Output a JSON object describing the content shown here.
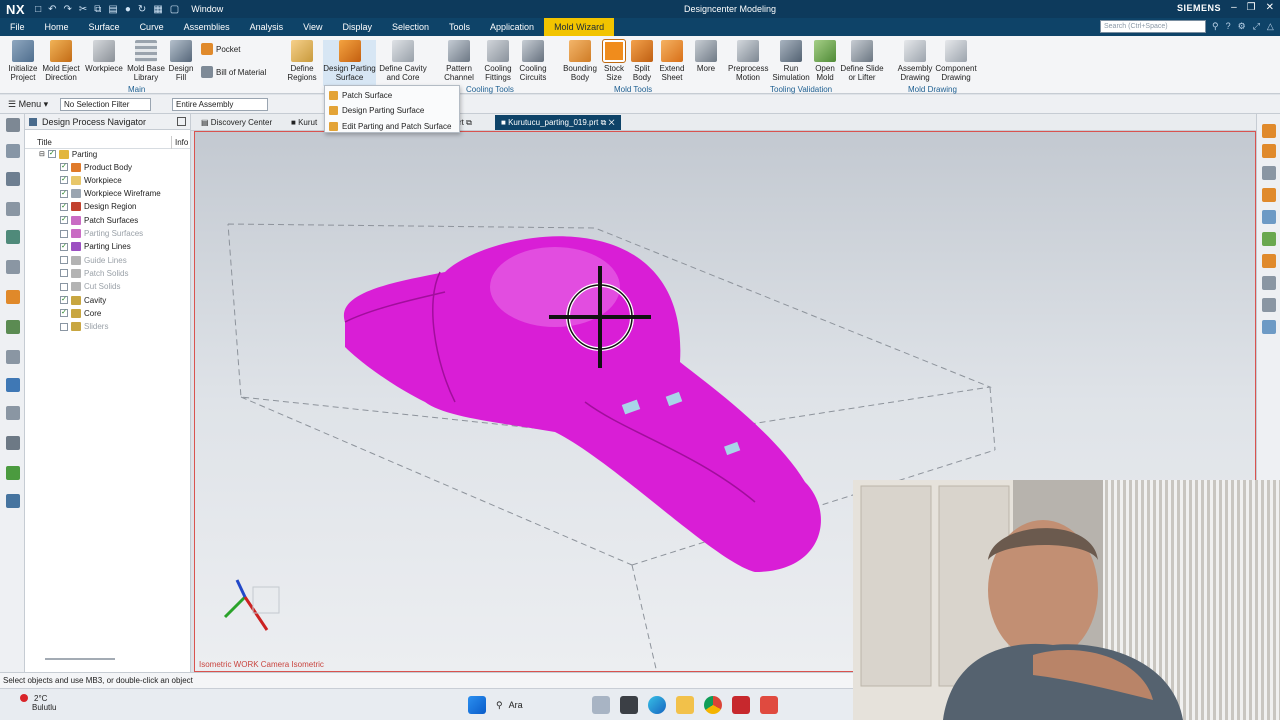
{
  "title_bar": {
    "logo": "NX",
    "window_menu": "Window",
    "app_title": "Designcenter Modeling",
    "brand": "SIEMENS"
  },
  "menu_bar": {
    "items": [
      "File",
      "Home",
      "Surface",
      "Curve",
      "Assemblies",
      "Analysis",
      "View",
      "Display",
      "Selection",
      "Tools",
      "Application",
      "Mold Wizard"
    ],
    "active": "Mold Wizard",
    "search_placeholder": "Search (Ctrl+Space)"
  },
  "ribbon": {
    "buttons": [
      {
        "label": "Initialize Project"
      },
      {
        "label": "Mold Eject Direction"
      },
      {
        "label": "Workpiece"
      },
      {
        "label": "Mold Base Library"
      },
      {
        "label": "Design Fill"
      },
      {
        "label": "Define Regions"
      },
      {
        "label": "Design Parting Surface"
      },
      {
        "label": "Define Cavity and Core"
      },
      {
        "label": "Pattern Channel"
      },
      {
        "label": "Cooling Fittings"
      },
      {
        "label": "Cooling Circuits"
      },
      {
        "label": "Bounding Body"
      },
      {
        "label": "Stock Size"
      },
      {
        "label": "Split Body"
      },
      {
        "label": "Extend Sheet"
      },
      {
        "label": "More"
      },
      {
        "label": "Preprocess Motion"
      },
      {
        "label": "Run Simulation"
      },
      {
        "label": "Open Mold"
      },
      {
        "label": "Define Slide or Lifter"
      },
      {
        "label": "Assembly Drawing"
      },
      {
        "label": "Component Drawing"
      }
    ],
    "small_buttons": {
      "pocket": "Pocket",
      "bom": "Bill of Material"
    },
    "groups": [
      "Main",
      "Cooling Tools",
      "Mold Tools",
      "Tooling Validation",
      "Mold Drawing"
    ]
  },
  "selection_bar": {
    "menu": "Menu",
    "filter": "No Selection Filter",
    "scope": "Entire Assembly"
  },
  "dropdown": {
    "items": [
      "Patch Surface",
      "Design Parting Surface",
      "Edit Parting and Patch Surface"
    ]
  },
  "navigator": {
    "title": "Design Process Navigator",
    "col_title": "Title",
    "col_info": "Info",
    "root": "Parting",
    "items": [
      {
        "label": "Product Body",
        "checked": true,
        "dim": false
      },
      {
        "label": "Workpiece",
        "checked": true,
        "dim": false
      },
      {
        "label": "Workpiece Wireframe",
        "checked": true,
        "dim": false
      },
      {
        "label": "Design Region",
        "checked": true,
        "dim": false
      },
      {
        "label": "Patch Surfaces",
        "checked": true,
        "dim": false
      },
      {
        "label": "Parting Surfaces",
        "checked": false,
        "dim": true
      },
      {
        "label": "Parting Lines",
        "checked": true,
        "dim": false
      },
      {
        "label": "Guide Lines",
        "checked": false,
        "dim": true
      },
      {
        "label": "Patch Solids",
        "checked": false,
        "dim": true
      },
      {
        "label": "Cut Solids",
        "checked": false,
        "dim": true
      },
      {
        "label": "Cavity",
        "checked": true,
        "dim": false
      },
      {
        "label": "Core",
        "checked": true,
        "dim": false
      },
      {
        "label": "Sliders",
        "checked": false,
        "dim": true
      }
    ]
  },
  "tabs": {
    "discovery": "Discovery Center",
    "kurut_partial": "Kurut",
    "rt_partial": "rt",
    "active": "Kurutucu_parting_019.prt"
  },
  "viewport": {
    "label": "Isometric WORK Camera Isometric"
  },
  "status": "Select objects and use MB3, or double-click an object",
  "taskbar": {
    "temperature": "2°C",
    "weather": "Bulutlu",
    "search": "Ara"
  },
  "colors": {
    "titlebar": "#0d3a5c",
    "menubar": "#0e4368",
    "active_menu": "#f2c400",
    "part": "#d91ed6"
  }
}
